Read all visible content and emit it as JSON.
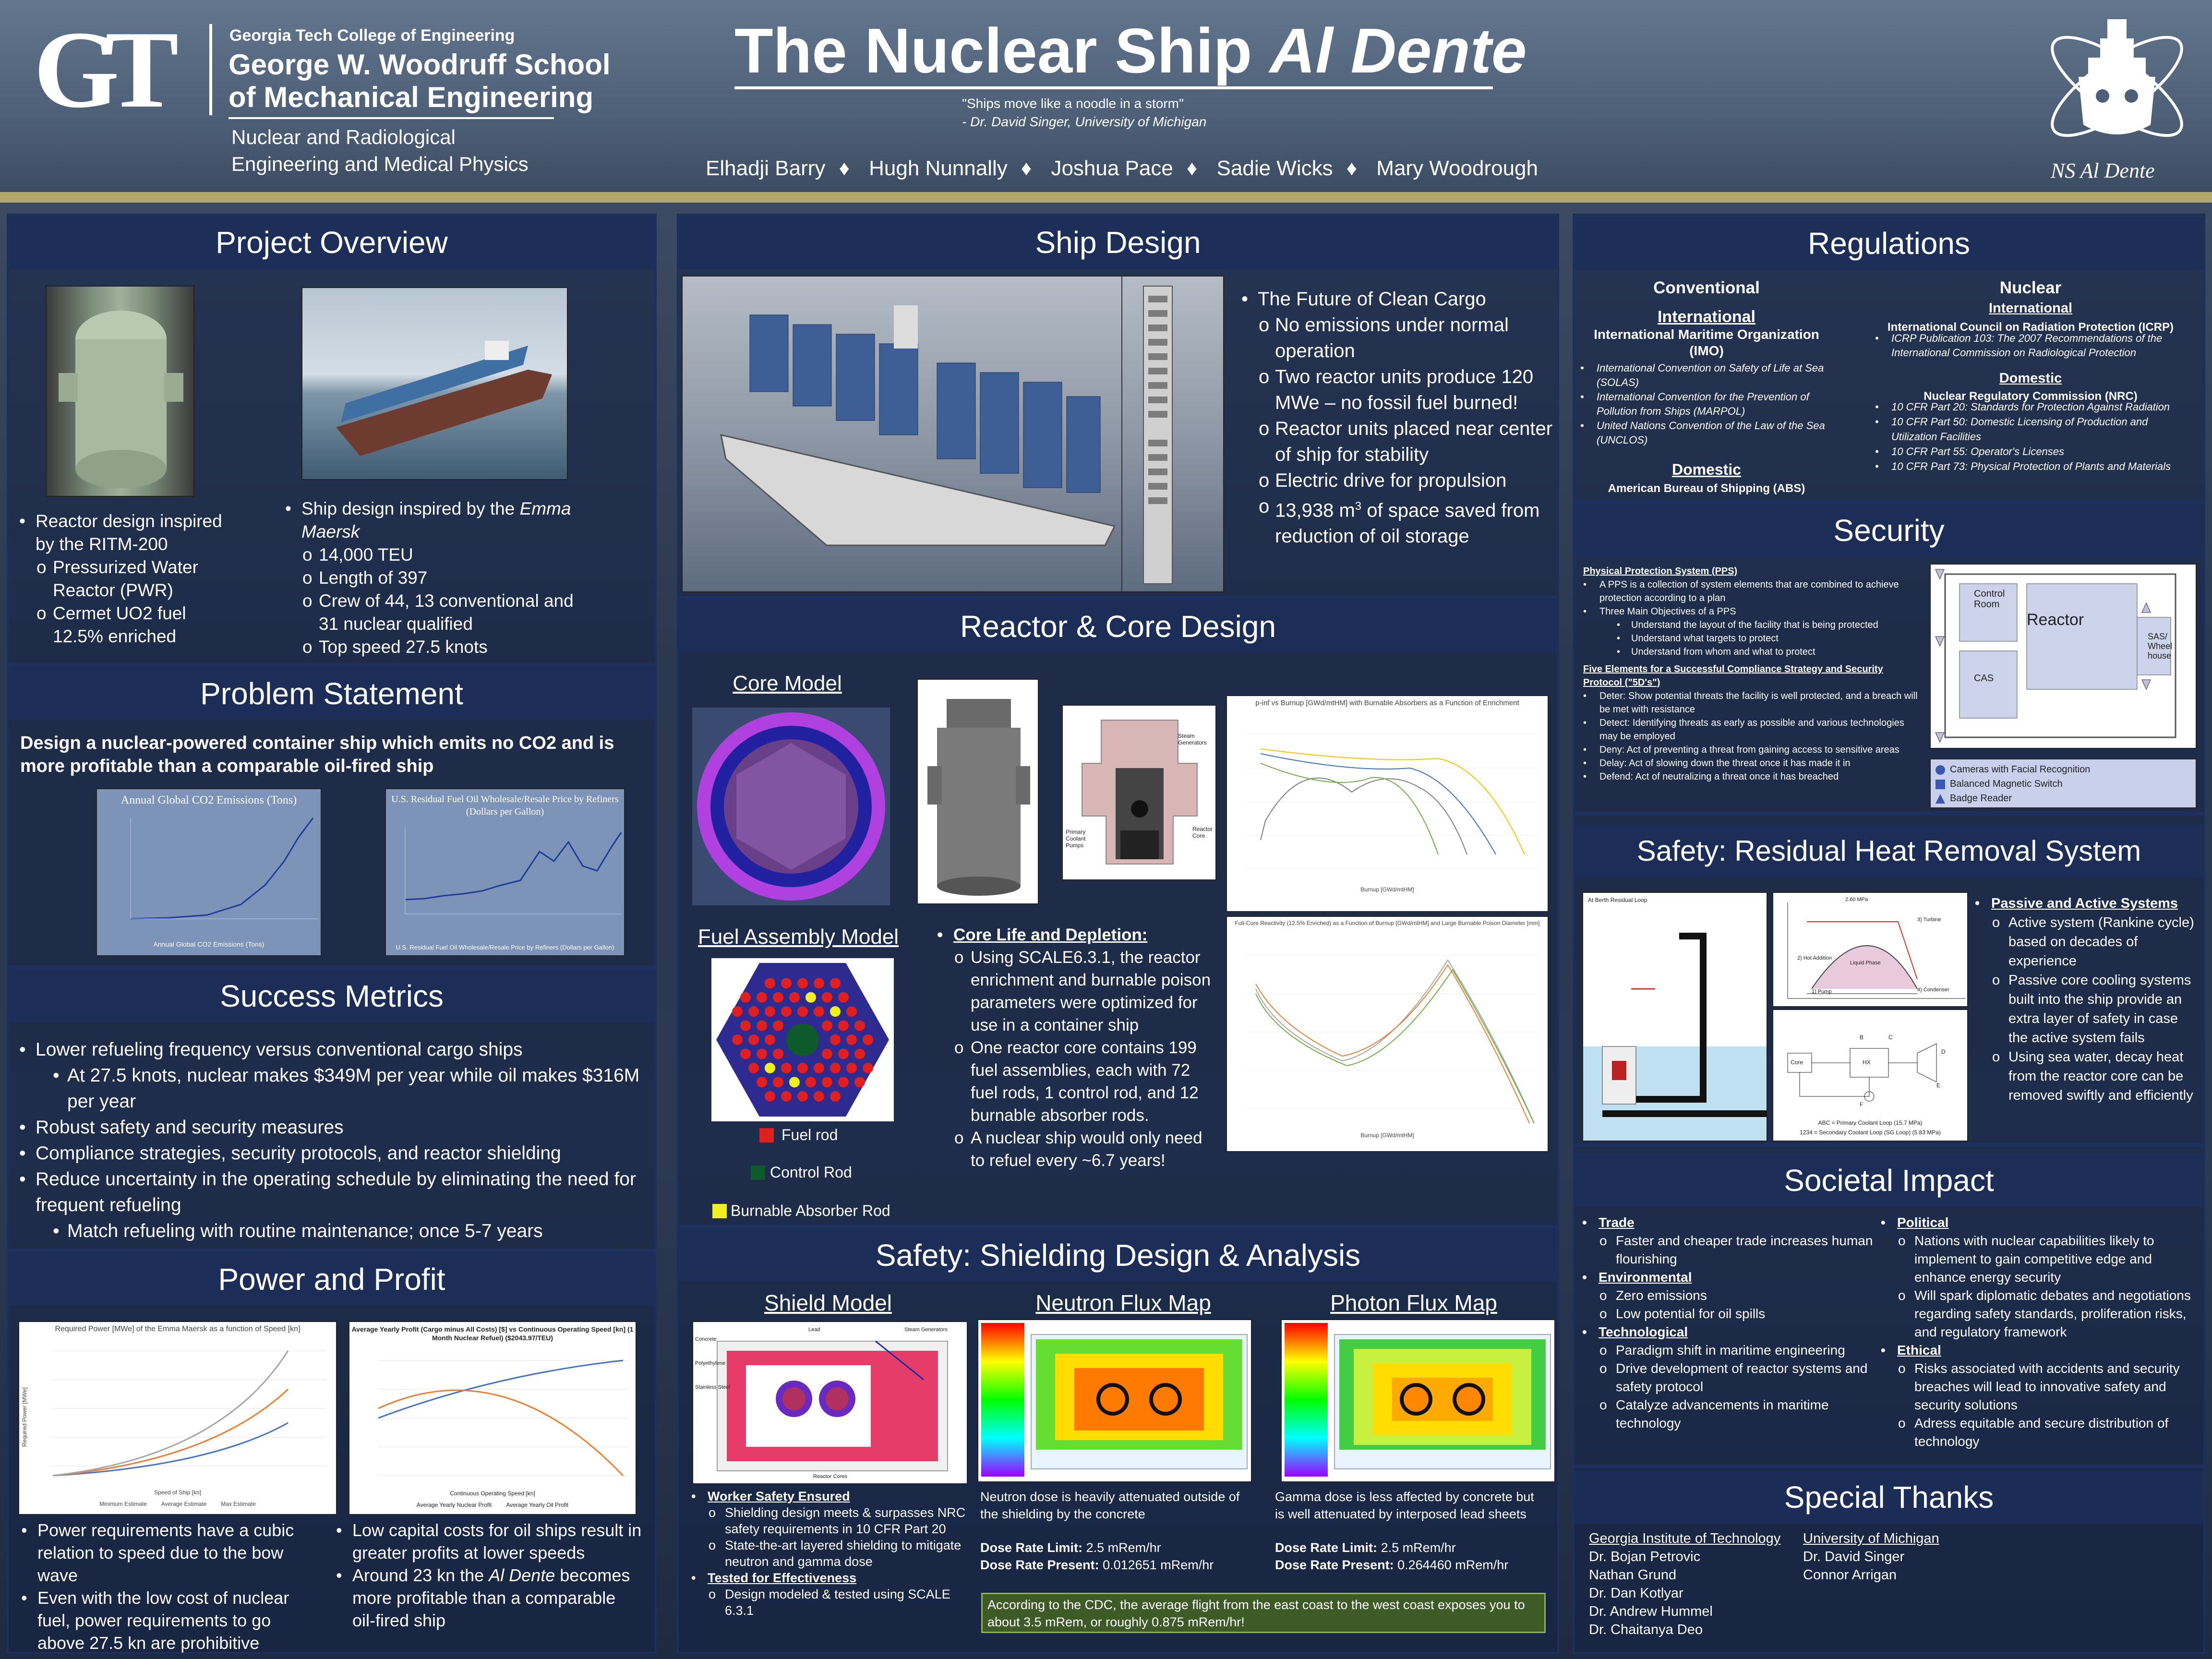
{
  "header": {
    "college": "Georgia Tech College of Engineering",
    "school_line1": "George W. Woodruff School",
    "school_line2": "of Mechanical Engineering",
    "dept_line1": "Nuclear and Radiological",
    "dept_line2": "Engineering and Medical Physics",
    "title_main": "The Nuclear Ship ",
    "title_italic": "Al Dente",
    "quote": "\"Ships move like a noodle in a storm\"",
    "quote_author": "- Dr. David Singer, University of Michigan",
    "authors": [
      "Elhadji Barry",
      "Hugh Nunnally",
      "Joshua Pace",
      "Sadie Wicks",
      "Mary Woodrough"
    ],
    "separator": "♦",
    "ship_logo_text": "NS Al Dente",
    "gt_logo": "GT"
  },
  "overview": {
    "title": "Project Overview",
    "left_bullets": [
      {
        "level": 0,
        "text": "Reactor design inspired by  the RITM-200"
      },
      {
        "level": 1,
        "text": "Pressurized Water Reactor (PWR)"
      },
      {
        "level": 1,
        "text": "Cermet UO2 fuel 12.5% enriched"
      }
    ],
    "right_pre": "Ship design inspired by the ",
    "right_italic": "Emma Maersk",
    "right_bullets": [
      "14,000 TEU",
      "Length of 397",
      "Crew of 44, 13 conventional and 31 nuclear qualified",
      "Top speed 27.5 knots"
    ]
  },
  "problem": {
    "title": "Problem Statement",
    "statement": "Design a nuclear-powered container ship which emits no CO2 and is more profitable than a comparable oil-fired ship",
    "chart1_title": "Annual Global CO2 Emissions (Tons)",
    "chart1_legend": "Annual Global CO2 Emissions (Tons)",
    "chart2_title": "U.S. Residual Fuel Oil Wholesale/Resale Price by Refiners (Dollars per Gallon)",
    "chart2_legend": "U.S. Residual Fuel Oil Wholesale/Resale Price by Refiners (Dollars per Gallon)"
  },
  "metrics": {
    "title": "Success Metrics",
    "bullets": [
      {
        "level": 0,
        "text": "Lower refueling frequency versus conventional cargo ships"
      },
      {
        "level": 1,
        "text": "At 27.5 knots, nuclear makes $349M per year while oil makes $316M per year"
      },
      {
        "level": 0,
        "text": "Robust safety and security measures"
      },
      {
        "level": 0,
        "text": "Compliance strategies, security protocols, and reactor shielding"
      },
      {
        "level": 0,
        "text": "Reduce uncertainty in the operating schedule by eliminating the need for frequent refueling"
      },
      {
        "level": 1,
        "text": "Match refueling with routine maintenance; once 5-7 years"
      }
    ]
  },
  "power": {
    "title": "Power and Profit",
    "chart1_title": "Required Power [MWe] of the Emma Maersk as a function of Speed [kn]",
    "chart1_xlabel": "Speed of Ship [kn]",
    "chart1_ylabel": "Required Power [MWe]",
    "chart1_legend": [
      "Minimum Estimate",
      "Average Estimate",
      "Max Estimate"
    ],
    "chart2_title": "Average Yearly Profit (Cargo minus All Costs) [$] vs Continuous Operating Speed [kn] (1 Month Nuclear Refuel) ($2043.97/TEU)",
    "chart2_xlabel": "Continuous Operating Speed [kn]",
    "chart2_legend": [
      "Average Yearly Nuclear Profit",
      "Average Yearly Oil Profit"
    ],
    "left_bullets": [
      "Power requirements have a cubic relation to speed due to the bow wave",
      "Even with the low cost of nuclear fuel,  power requirements to go above 27.5 kn are prohibitive"
    ],
    "right_b1": "Low capital costs for oil ships result in greater profits at lower speeds",
    "right_b2_pre": "Around 23 kn the ",
    "right_b2_italic": "Al Dente",
    "right_b2_post": " becomes more profitable than a comparable oil-fired ship"
  },
  "ship": {
    "title": "Ship Design",
    "bullets": [
      {
        "level": 0,
        "text": "The Future of Clean Cargo"
      },
      {
        "level": 1,
        "text": "No emissions under normal operation"
      },
      {
        "level": 1,
        "text": "Two reactor units produce 120 MWe – no fossil fuel burned!"
      },
      {
        "level": 1,
        "text": "Reactor units placed near center of ship for stability"
      },
      {
        "level": 1,
        "text": "Electric drive for propulsion"
      }
    ],
    "last_pre": "13,938 m",
    "last_sup": "3",
    "last_post": " of space saved from reduction of oil storage"
  },
  "reactor": {
    "title": "Reactor & Core Design",
    "core_model": "Core Model",
    "fuel_model": "Fuel Assembly Model",
    "diagram_labels": [
      "Steam Generators",
      "Primary Coolant Pumps",
      "Reactor Core"
    ],
    "legend": [
      "Fuel rod",
      "Control Rod",
      "Burnable Absorber Rod"
    ],
    "chart1_title": "p-inf vs Burnup [GWd/mtHM] with Burnable Absorbers as a Function of Enrichment",
    "chart1_xlabel": "Burnup [GWd/mtHM]",
    "chart2_title": "Full-Core Reactivity (12.5% Enriched) as a Function of Burnup [GWd/mtHM] and Large Burnable Poison Diameter [mm]",
    "chart2_xlabel": "Burnup [GWd/mtHM]",
    "life_heading": "Core Life and Depletion:",
    "life_bullets": [
      "Using SCALE6.3.1, the reactor enrichment and burnable poison parameters were optimized for use in a container ship",
      "One reactor core contains 199 fuel assemblies, each with 72 fuel rods, 1 control rod, and 12 burnable absorber rods.",
      "A nuclear ship would only need to refuel every ~6.7 years!"
    ]
  },
  "shielding": {
    "title": "Safety: Shielding Design & Analysis",
    "shield_model": "Shield Model",
    "neutron_map": "Neutron Flux Map",
    "photon_map": "Photon Flux Map",
    "shield_labels": [
      "Concrete",
      "Lead",
      "Polyethylene",
      "Stainless Steel",
      "Steam Generators",
      "Reactor Cores"
    ],
    "worker_heading": "Worker Safety Ensured",
    "worker_bullets": [
      "Shielding design meets & surpasses NRC safety requirements in 10 CFR Part 20",
      "State-the-art layered shielding to mitigate neutron and gamma dose"
    ],
    "tested_heading": "Tested for Effectiveness",
    "tested_bullets": [
      "Design modeled & tested using SCALE 6.3.1"
    ],
    "neutron_text": "Neutron dose is heavily attenuated outside of the shielding by the concrete",
    "photon_text": "Gamma dose is less affected by concrete but is well attenuated by interposed lead sheets",
    "limit_label": "Dose Rate Limit:",
    "limit_value": "2.5 mRem/hr",
    "present_label": "Dose Rate Present:",
    "neutron_present": "0.012651 mRem/hr",
    "photon_present": "0.264460 mRem/hr",
    "cdc_note": "According to the CDC, the average flight from the east coast to the west coast exposes you to about 3.5 mRem, or roughly 0.875 mRem/hr!"
  },
  "regulations": {
    "title": "Regulations",
    "conventional": "Conventional",
    "nuclear": "Nuclear",
    "intl": "International",
    "domestic": "Domestic",
    "imo": "International Maritime Organization (IMO)",
    "conv_intl_items": [
      "International Convention on Safety of Life at Sea (SOLAS)",
      "International Convention for the Prevention of Pollution from Ships (MARPOL)",
      "United Nations Convention of the Law of the Sea (UNCLOS)"
    ],
    "abs": "American Bureau of Shipping (ABS)",
    "icrp": "International Council on Radiation Protection (ICRP)",
    "nuc_intl_items": [
      "ICRP Publication 103: The 2007 Recommendations of the International Commission on Radiological Protection"
    ],
    "nrc": "Nuclear Regulatory Commission (NRC)",
    "nuc_dom_items": [
      "10 CFR Part 20: Standards for Protection Against Radiation",
      "10 CFR Part 50: Domestic Licensing of Production and Utilization Facilities",
      "10 CFR Part 55: Operator's Licenses",
      "10 CFR Part 73: Physical Protection of Plants and Materials"
    ]
  },
  "security": {
    "title": "Security",
    "pps_heading": "Physical Protection System (PPS)",
    "pps_items": [
      {
        "level": 0,
        "text": "A PPS is a collection of system elements that are combined to achieve protection according to a plan"
      },
      {
        "level": 0,
        "text": "Three Main Objectives of a PPS"
      },
      {
        "level": 1,
        "text": "Understand the layout of the facility that is being protected"
      },
      {
        "level": 1,
        "text": "Understand what targets to protect"
      },
      {
        "level": 1,
        "text": "Understand from whom and what to protect"
      }
    ],
    "five_heading": "Five Elements for a Successful Compliance Strategy and Security Protocol (\"5D's\")",
    "five_items": [
      "Deter: Show potential threats the facility is well protected, and a breach will be met with resistance",
      "Detect: Identifying threats as early as possible and various technologies may be employed",
      "Deny: Act of preventing a threat from gaining access to sensitive areas",
      "Delay: Act of slowing down the threat once it has made it in",
      "Defend: Act of neutralizing a threat once it has breached"
    ],
    "map_labels": [
      "Control Room",
      "Reactor",
      "SAS/ Wheel house",
      "CAS"
    ],
    "map_legend": [
      "Cameras with Facial Recognition",
      "Balanced Magnetic Switch",
      "Badge Reader"
    ]
  },
  "rhr": {
    "title": "Safety: Residual Heat Removal System",
    "heading": "Passive and Active Systems",
    "bullets": [
      "Active system (Rankine cycle) based on decades of experience",
      "Passive core cooling systems built into the ship provide an extra layer of safety in case the active system fails",
      "Using sea water, decay heat from the reactor core can be removed swiftly and efficiently"
    ],
    "diagram_labels": [
      "At Berth Residual Loop",
      "2.60 MPa",
      "3) Turbine",
      "4) Condenser",
      "2) Hot Addition",
      "1) Pump",
      "Liquid Phase",
      "B",
      "C",
      "D",
      "E",
      "F",
      "Core",
      "HX",
      "ABC = Primary Coolant Loop (15.7 MPa)",
      "1234 = Secondary Coolant Loop (SG Loop) (5.83 MPa)"
    ]
  },
  "societal": {
    "title": "Societal Impact",
    "left": [
      {
        "heading": "Trade",
        "items": [
          "Faster and cheaper trade increases human flourishing"
        ]
      },
      {
        "heading": "Environmental",
        "items": [
          "Zero emissions",
          "Low potential for oil spills"
        ]
      },
      {
        "heading": "Technological",
        "items": [
          "Paradigm shift in maritime engineering",
          "Drive development of reactor systems and safety protocol",
          "Catalyze advancements in maritime technology"
        ]
      }
    ],
    "right": [
      {
        "heading": "Political",
        "items": [
          "Nations with nuclear capabilities likely to implement to gain competitive edge and enhance energy security",
          "Will spark diplomatic debates and negotiations regarding safety standards, proliferation risks, and regulatory framework"
        ]
      },
      {
        "heading": "Ethical",
        "items": [
          "Risks associated with accidents and security breaches will lead to innovative safety and security solutions",
          "Adress equitable and secure distribution of technology"
        ]
      }
    ]
  },
  "thanks": {
    "title": "Special Thanks",
    "col1_heading": "Georgia Institute of Technology",
    "col1": [
      "Dr. Bojan Petrovic",
      "Nathan Grund",
      "Dr. Dan Kotlyar",
      "Dr. Andrew Hummel",
      "Dr. Chaitanya Deo"
    ],
    "col2_heading": "University of Michigan",
    "col2": [
      "Dr. David Singer",
      "Connor Arrigan"
    ]
  },
  "colors": {
    "panel": "#14234a",
    "panel_title": "#1c2e5c",
    "gold": "#b3a86a",
    "fuel_rod": "#e02020",
    "control_rod": "#0f5a2a",
    "absorber_rod": "#f0f020",
    "core_ring": "#b040e0"
  }
}
